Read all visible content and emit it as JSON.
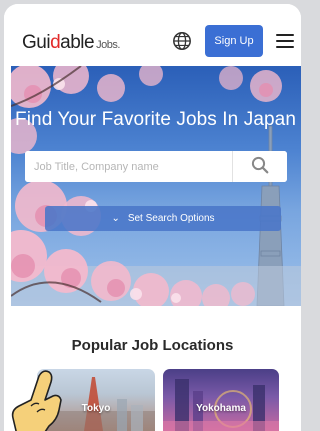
{
  "header": {
    "logo_prefix": "Gui",
    "logo_accent": "d",
    "logo_suffix": "able",
    "logo_small": "Jobs.",
    "signup_label": "Sign Up",
    "globe_icon": "globe-icon",
    "menu_icon": "hamburger-menu-icon"
  },
  "hero": {
    "title": "Find Your Favorite Jobs In Japan",
    "search_placeholder": "Job Title, Company name",
    "search_value": "",
    "search_icon": "search-icon",
    "options_label": "Set Search Options",
    "options_icon": "chevron-down-icon"
  },
  "locations": {
    "title": "Popular Job Locations",
    "cards": [
      {
        "label": "Tokyo"
      },
      {
        "label": "Yokohama"
      }
    ]
  },
  "colors": {
    "brand_blue": "#3b6fd4",
    "logo_accent": "#e32b2b",
    "sky_blue": "#4d83d1"
  }
}
